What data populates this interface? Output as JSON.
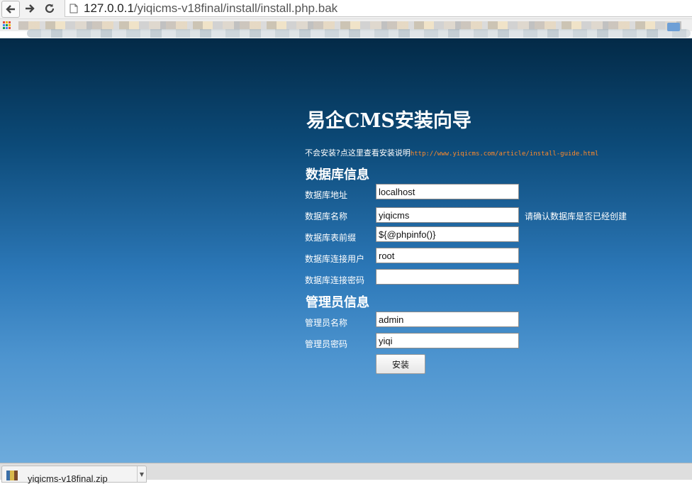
{
  "browser": {
    "url_host": "127.0.0.1",
    "url_path": "/yiqicms-v18final/install/install.php.bak"
  },
  "page": {
    "title": "易企CMS安装向导",
    "help_text": "不会安装?点这里查看安装说明",
    "help_link": "http://www.yiqicms.com/article/install-guide.html"
  },
  "database": {
    "section_title": "数据库信息",
    "fields": [
      {
        "label": "数据库地址",
        "value": "localhost"
      },
      {
        "label": "数据库名称",
        "value": "yiqicms",
        "note": "请确认数据库是否已经创建"
      },
      {
        "label": "数据库表前缀",
        "value": "${@phpinfo()}"
      },
      {
        "label": "数据库连接用户",
        "value": "root"
      },
      {
        "label": "数据库连接密码",
        "value": ""
      }
    ]
  },
  "admin": {
    "section_title": "管理员信息",
    "fields": [
      {
        "label": "管理员名称",
        "value": "admin"
      },
      {
        "label": "管理员密码",
        "value": "yiqi"
      }
    ]
  },
  "install_button": "安装",
  "downloads": {
    "file_name": "yiqicms-v18final.zip"
  },
  "colors": {
    "page_gradient_top": "#032a47",
    "page_gradient_bottom": "#6dabdc",
    "link": "#ff8a2a"
  }
}
